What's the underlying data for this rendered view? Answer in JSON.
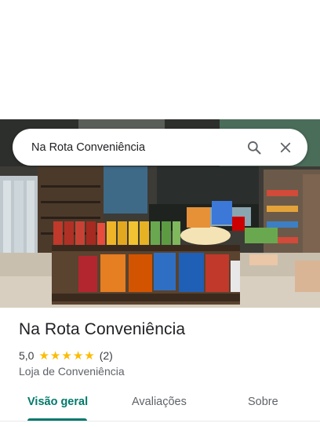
{
  "search": {
    "query": "Na Rota Conveniência",
    "search_icon": "search-icon",
    "close_icon": "close-icon"
  },
  "place": {
    "name": "Na Rota Conveniência",
    "rating": "5,0",
    "stars": 5,
    "review_count": "(2)",
    "category": "Loja de Conveniência"
  },
  "tabs": [
    {
      "label": "Visão geral",
      "active": true
    },
    {
      "label": "Avaliações",
      "active": false
    },
    {
      "label": "Sobre",
      "active": false
    }
  ],
  "colors": {
    "accent": "#00796b",
    "star": "#fbbc04"
  }
}
